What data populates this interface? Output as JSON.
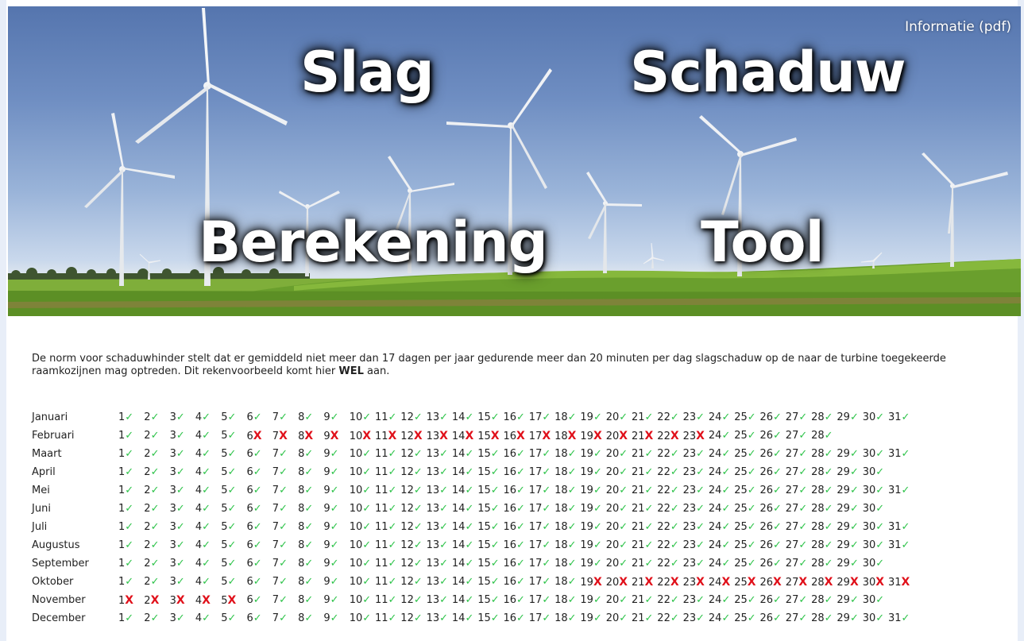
{
  "header": {
    "info_link": "Informatie (pdf)",
    "title_words": [
      "Slag",
      "Schaduw",
      "Berekening",
      "Tool"
    ]
  },
  "description": {
    "text_before": "De norm voor schaduwhinder stelt dat er gemiddeld niet meer dan 17 dagen per jaar gedurende meer dan 20 minuten per dag slagschaduw op de naar de turbine toegekeerde raamkozijnen mag optreden. Dit rekenvoorbeeld komt hier ",
    "emphasis": "WEL",
    "text_after": " aan."
  },
  "symbols": {
    "ok": "✓",
    "exceeded": "X"
  },
  "colors": {
    "ok": "#2ec34a",
    "exceeded": "#e0101a",
    "text": "#222222",
    "sky": "#6f8ec2",
    "grass": "#6ea12c"
  },
  "calendar": [
    {
      "month": "Januari",
      "days": 31,
      "exceeded": []
    },
    {
      "month": "Februari",
      "days": 28,
      "exceeded": [
        6,
        7,
        8,
        9,
        10,
        11,
        12,
        13,
        14,
        15,
        16,
        17,
        18,
        19,
        20,
        21,
        22,
        23
      ]
    },
    {
      "month": "Maart",
      "days": 31,
      "exceeded": []
    },
    {
      "month": "April",
      "days": 30,
      "exceeded": []
    },
    {
      "month": "Mei",
      "days": 31,
      "exceeded": []
    },
    {
      "month": "Juni",
      "days": 30,
      "exceeded": []
    },
    {
      "month": "Juli",
      "days": 31,
      "exceeded": []
    },
    {
      "month": "Augustus",
      "days": 31,
      "exceeded": []
    },
    {
      "month": "September",
      "days": 30,
      "exceeded": []
    },
    {
      "month": "Oktober",
      "days": 31,
      "exceeded": [
        19,
        20,
        21,
        22,
        23,
        24,
        25,
        26,
        27,
        28,
        29,
        30,
        31
      ]
    },
    {
      "month": "November",
      "days": 30,
      "exceeded": [
        1,
        2,
        3,
        4,
        5
      ]
    },
    {
      "month": "December",
      "days": 31,
      "exceeded": []
    }
  ]
}
